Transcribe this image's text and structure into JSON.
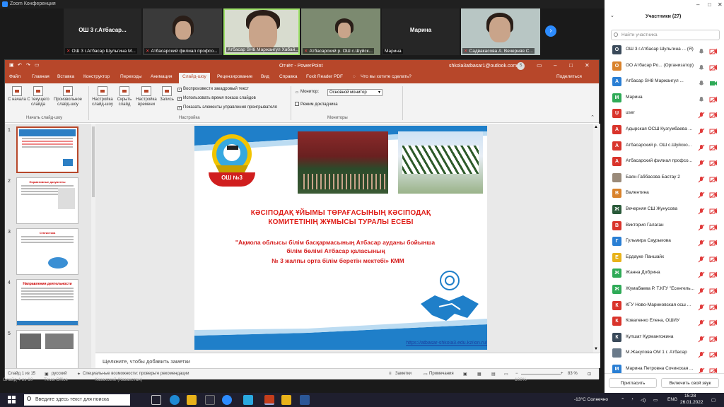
{
  "zoom": {
    "window_title": "Zoom Конференция",
    "tiles": [
      {
        "big": "ОШ 3 г.Атбасар...",
        "caption": "ОШ 3 г.Атбасар Шульгина М..."
      },
      {
        "big": "",
        "caption": "Атбасарский филиал профсо..."
      },
      {
        "big": "",
        "caption": "Атбасар SH8 Маржангул Хабай..."
      },
      {
        "big": "",
        "caption": "Атбасарский р. ОШ с.Шуйск..."
      },
      {
        "big": "Марина",
        "caption": "Марина"
      },
      {
        "big": "",
        "caption": "Садвакасова А. Вечерняя С..."
      }
    ]
  },
  "ppt": {
    "doc_title": "Отчёт - PowerPoint",
    "account": "shkola3atbasar1@outlook.com",
    "account_initial": "S",
    "tabs": [
      "Файл",
      "Главная",
      "Вставка",
      "Конструктор",
      "Переходы",
      "Анимация",
      "Слайд-шоу",
      "Рецензирование",
      "Вид",
      "Справка",
      "Foxit Reader PDF",
      "Что вы хотите сделать?"
    ],
    "share": "Поделиться",
    "ribbon": {
      "btn_from_start": "С начала",
      "btn_from_current": "С текущего слайда",
      "btn_custom": "Произвольное слайд-шоу",
      "group_start": "Начать слайд-шоу",
      "btn_setup": "Настройка слайд-шоу",
      "btn_hide": "Скрыть слайд",
      "btn_timing": "Настройка времени",
      "btn_record": "Запись",
      "chk_narration": "Воспроизвести закадровый текст",
      "chk_timings": "Использовать время показа слайдов",
      "chk_controls": "Показать элементы управления проигрывателя",
      "group_setup": "Настройка",
      "monitor_label": "Монитор:",
      "monitor_value": "Основной монитор",
      "presenter_view": "Режим докладчика",
      "group_monitors": "Мониторы"
    },
    "thumb_numbers": [
      "1",
      "2",
      "3",
      "4",
      "5"
    ],
    "thumb_titles": [
      "",
      "Нормативные документы",
      "Статистика",
      "Направления деятельности",
      ""
    ],
    "slide": {
      "badge": "ОШ №3",
      "title_line1": "КӘСІПОДАҚ ҰЙЫМЫ ТӨРАҒАСЫНЫҢ КӘСІПОДАҚ",
      "title_line2": "КОМИТЕТІНІҢ ЖҰМЫСЫ ТУРАЛЫ ЕСЕБІ",
      "sub_line1": "\"Ақмола облысы білім басқармасының Атбасар ауданы бойынша",
      "sub_line2": "білім бөлімі Атбасар қаласының",
      "sub_line3": "№ 3 жалпы  орта білім беретін мектебі» КММ",
      "link": "https://atbasar-shkola3.edu.kz/ion.ru/"
    },
    "notes_placeholder": "Щелкните, чтобы добавить заметки",
    "status": {
      "slide_info": "Слайд 1 из 15",
      "language": "русский",
      "accessibility": "Специальные возможности: проверьте рекомендации",
      "notes": "Заметки",
      "comments": "Примечания",
      "zoom": "83 %"
    }
  },
  "participants": {
    "header": "Участники (27)",
    "search_placeholder": "Найти участника",
    "list": [
      {
        "initial": "О",
        "color": "#3a4a5a",
        "name": "ОШ 3 г.Атбасар Шульгина ... (Я)",
        "mic": "on",
        "cam": "off"
      },
      {
        "initial": "О",
        "color": "#d9822b",
        "name": "ОО Атбасар Ро... (Организатор)",
        "mic": "on",
        "cam": "off"
      },
      {
        "initial": "А",
        "color": "#2a7fd4",
        "name": "Атбасар SH8  Маржангул ...",
        "mic": "on",
        "cam": "on"
      },
      {
        "initial": "М",
        "color": "#2faa57",
        "name": "Марина",
        "mic": "on",
        "cam": "off"
      },
      {
        "initial": "U",
        "color": "#d9342b",
        "name": "user",
        "mic": "off",
        "cam": "off"
      },
      {
        "initial": "А",
        "color": "#d9342b",
        "name": "Адырская ОСШ Кузгумбаева ...",
        "mic": "off",
        "cam": "off"
      },
      {
        "initial": "А",
        "color": "#d9342b",
        "name": "Атбасарский р. ОШ с.Шуйско...",
        "mic": "off",
        "cam": "off"
      },
      {
        "initial": "А",
        "color": "#d9342b",
        "name": "Атбасарский филиал профсо...",
        "mic": "off",
        "cam": "off"
      },
      {
        "initial": "",
        "color": "#9a8a7a",
        "name": "Баян-Габбасова Бастау 2",
        "mic": "off",
        "cam": "off"
      },
      {
        "initial": "В",
        "color": "#d9822b",
        "name": "Валентина",
        "mic": "off",
        "cam": "off"
      },
      {
        "initial": "Ж",
        "color": "#2a5a3a",
        "name": "Вечерняя СШ Жунусова",
        "mic": "off",
        "cam": "off"
      },
      {
        "initial": "В",
        "color": "#d9342b",
        "name": "Виктория Галаган",
        "mic": "off",
        "cam": "off"
      },
      {
        "initial": "Г",
        "color": "#2a7fd4",
        "name": "Гульмира Саурыкова",
        "mic": "off",
        "cam": "off"
      },
      {
        "initial": "Е",
        "color": "#e8b21a",
        "name": "Ердауке Паншайх",
        "mic": "off",
        "cam": "off"
      },
      {
        "initial": "Ж",
        "color": "#2faa57",
        "name": "Жанна Добрина",
        "mic": "off",
        "cam": "off"
      },
      {
        "initial": "Ж",
        "color": "#2faa57",
        "name": "Жумабаева Р. Т.КГУ \"Есенгель...",
        "mic": "off",
        "cam": "off"
      },
      {
        "initial": "К",
        "color": "#d9342b",
        "name": "КГУ Ново-Мариновская осш ...",
        "mic": "off",
        "cam": "off"
      },
      {
        "initial": "К",
        "color": "#d9342b",
        "name": "Коваленко Елена, ОШИУ",
        "mic": "off",
        "cam": "off"
      },
      {
        "initial": "К",
        "color": "#3a4a5a",
        "name": "Кулшат Курмангожина",
        "mic": "off",
        "cam": "off"
      },
      {
        "initial": "",
        "color": "#6a7a8a",
        "name": "М.Жакупова ОМ 1 г. Атбасар",
        "mic": "off",
        "cam": "off"
      },
      {
        "initial": "М",
        "color": "#2a7fd4",
        "name": "Марина Петровна Сочинская ...",
        "mic": "off",
        "cam": "off"
      }
    ],
    "btn_invite": "Пригласить",
    "btn_unmute": "Включить свой звук"
  },
  "behind_status": {
    "slide": "Слайд 4 из 10",
    "theme": "Тема Office",
    "lang": "Казахский (Казахстан)",
    "zoom": "100%"
  },
  "taskbar": {
    "search_placeholder": "Введите здесь текст для поиска",
    "weather": "-13°C  Солнечно",
    "lang": "ENG",
    "time": "15:28",
    "date": "26.01.2022"
  },
  "colors": {
    "ppt_accent": "#b7472a",
    "zoom_blue": "#2d8cff",
    "slide_red": "#e0201b"
  }
}
